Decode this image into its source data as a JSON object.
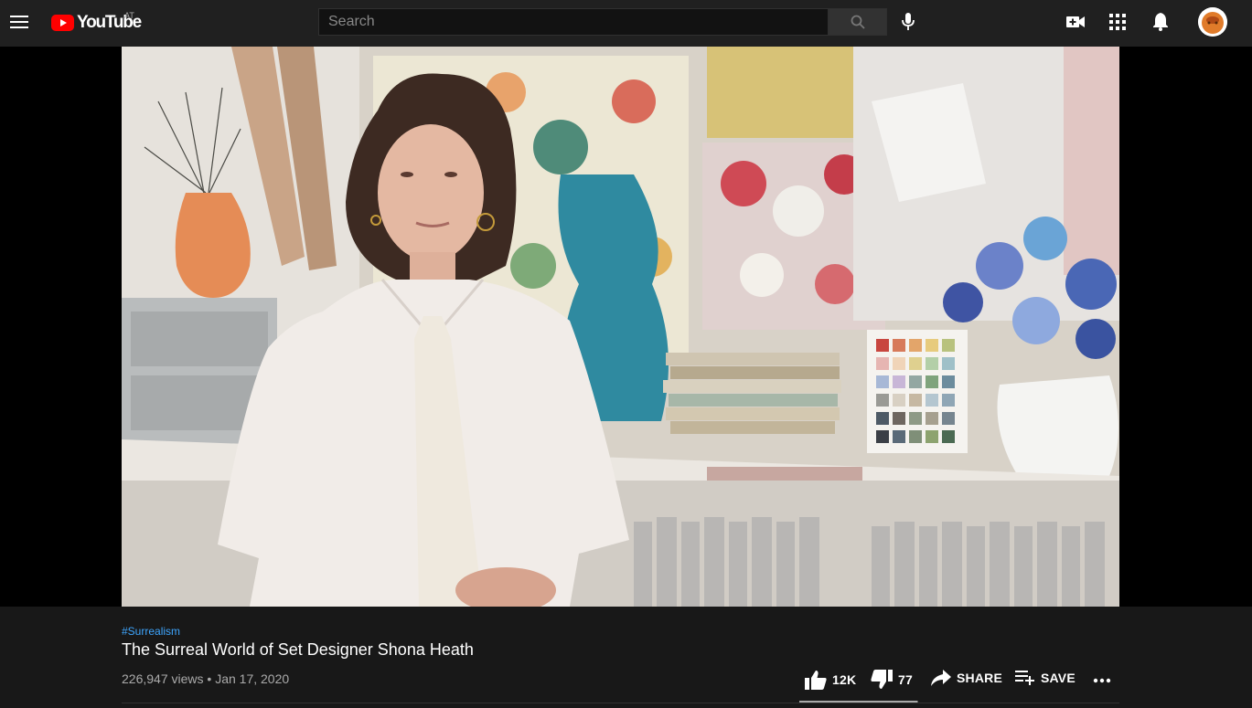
{
  "masthead": {
    "logo_text": "YouTube",
    "country_code": "AT",
    "search_placeholder": "Search",
    "icons": {
      "menu": "hamburger-menu-icon",
      "search": "search-icon",
      "mic": "microphone-icon",
      "create": "create-video-icon",
      "apps": "apps-grid-icon",
      "notifications": "bell-icon",
      "avatar": "user-avatar"
    }
  },
  "video": {
    "hashtag": "#Surrealism",
    "title": "The Surreal World of Set Designer Shona Heath",
    "views": "226,947 views",
    "separator": " • ",
    "date": "Jan 17, 2020"
  },
  "actions": {
    "likes": "12K",
    "dislikes": "77",
    "share": "SHARE",
    "save": "SAVE",
    "like_ratio": 0.99
  },
  "colors": {
    "background": "#181818",
    "masthead": "#202020",
    "brand_red": "#ff0000",
    "hashtag_blue": "#3ea6ff",
    "meta_gray": "#aaaaaa"
  }
}
